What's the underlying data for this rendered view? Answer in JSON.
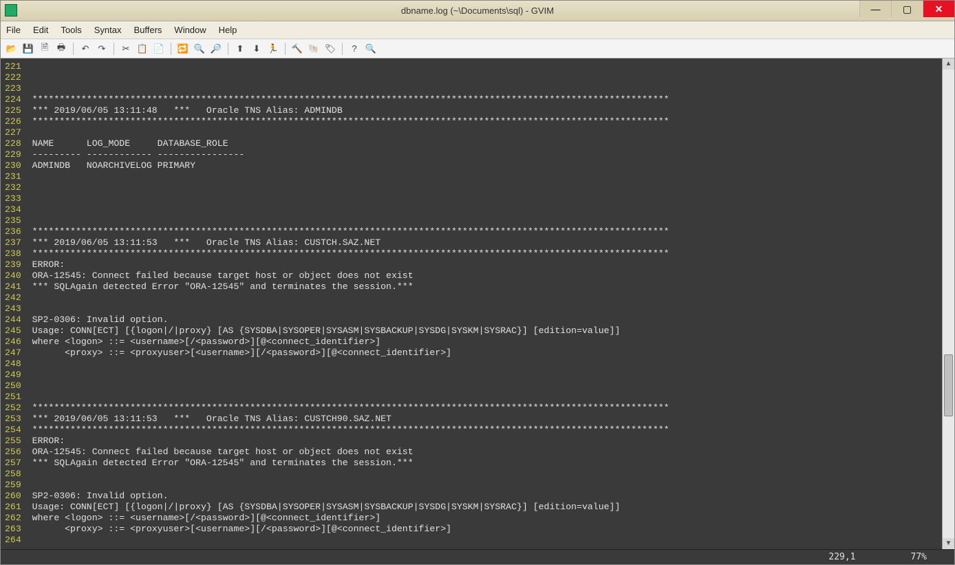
{
  "window": {
    "title": "dbname.log (~\\Documents\\sql) - GVIM",
    "icon": "gvim-icon"
  },
  "window_controls": {
    "min": "—",
    "max": "▢",
    "close": "✕"
  },
  "menubar": [
    "File",
    "Edit",
    "Tools",
    "Syntax",
    "Buffers",
    "Window",
    "Help"
  ],
  "toolbar_icons": [
    {
      "name": "open-icon",
      "glyph": "📂"
    },
    {
      "name": "save-icon",
      "glyph": "💾"
    },
    {
      "name": "save-all-icon",
      "glyph": "🗎"
    },
    {
      "name": "print-icon",
      "glyph": "🖶"
    },
    {
      "sep": true
    },
    {
      "name": "undo-icon",
      "glyph": "↶"
    },
    {
      "name": "redo-icon",
      "glyph": "↷"
    },
    {
      "sep": true
    },
    {
      "name": "cut-icon",
      "glyph": "✂"
    },
    {
      "name": "copy-icon",
      "glyph": "📋"
    },
    {
      "name": "paste-icon",
      "glyph": "📄"
    },
    {
      "sep": true
    },
    {
      "name": "replace-icon",
      "glyph": "🔁"
    },
    {
      "name": "find-next-icon",
      "glyph": "🔍"
    },
    {
      "name": "find-prev-icon",
      "glyph": "🔎"
    },
    {
      "sep": true
    },
    {
      "name": "load-session-icon",
      "glyph": "⬆"
    },
    {
      "name": "save-session-icon",
      "glyph": "⬇"
    },
    {
      "name": "run-script-icon",
      "glyph": "🏃"
    },
    {
      "sep": true
    },
    {
      "name": "make-icon",
      "glyph": "🔨"
    },
    {
      "name": "shell-icon",
      "glyph": "🐚"
    },
    {
      "name": "tags-icon",
      "glyph": "🏷"
    },
    {
      "sep": true
    },
    {
      "name": "help-icon",
      "glyph": "?"
    },
    {
      "name": "find-help-icon",
      "glyph": "🔍"
    }
  ],
  "lines": [
    {
      "n": "221",
      "t": ""
    },
    {
      "n": "222",
      "t": ""
    },
    {
      "n": "223",
      "t": ""
    },
    {
      "n": "224",
      "t": " *********************************************************************************************************************"
    },
    {
      "n": "225",
      "t": " *** 2019/06/05 13:11:48   ***   Oracle TNS Alias: ADMINDB"
    },
    {
      "n": "226",
      "t": " *********************************************************************************************************************"
    },
    {
      "n": "227",
      "t": ""
    },
    {
      "n": "228",
      "t": " NAME      LOG_MODE     DATABASE_ROLE"
    },
    {
      "n": "229",
      "t": " --------- ------------ ----------------"
    },
    {
      "n": "230",
      "t": " ADMINDB   NOARCHIVELOG PRIMARY"
    },
    {
      "n": "231",
      "t": ""
    },
    {
      "n": "232",
      "t": ""
    },
    {
      "n": "233",
      "t": ""
    },
    {
      "n": "234",
      "t": ""
    },
    {
      "n": "235",
      "t": ""
    },
    {
      "n": "236",
      "t": " *********************************************************************************************************************"
    },
    {
      "n": "237",
      "t": " *** 2019/06/05 13:11:53   ***   Oracle TNS Alias: CUSTCH.SAZ.NET"
    },
    {
      "n": "238",
      "t": " *********************************************************************************************************************"
    },
    {
      "n": "239",
      "t": " ERROR:"
    },
    {
      "n": "240",
      "t": " ORA-12545: Connect failed because target host or object does not exist"
    },
    {
      "n": "241",
      "t": " *** SQLAgain detected Error \"ORA-12545\" and terminates the session.***"
    },
    {
      "n": "242",
      "t": ""
    },
    {
      "n": "243",
      "t": ""
    },
    {
      "n": "244",
      "t": " SP2-0306: Invalid option."
    },
    {
      "n": "245",
      "t": " Usage: CONN[ECT] [{logon|/|proxy} [AS {SYSDBA|SYSOPER|SYSASM|SYSBACKUP|SYSDG|SYSKM|SYSRAC}] [edition=value]]"
    },
    {
      "n": "246",
      "t": " where <logon> ::= <username>[/<password>][@<connect_identifier>]"
    },
    {
      "n": "247",
      "t": "       <proxy> ::= <proxyuser>[<username>][/<password>][@<connect_identifier>]"
    },
    {
      "n": "248",
      "t": ""
    },
    {
      "n": "249",
      "t": ""
    },
    {
      "n": "250",
      "t": ""
    },
    {
      "n": "251",
      "t": ""
    },
    {
      "n": "252",
      "t": " *********************************************************************************************************************"
    },
    {
      "n": "253",
      "t": " *** 2019/06/05 13:11:53   ***   Oracle TNS Alias: CUSTCH90.SAZ.NET"
    },
    {
      "n": "254",
      "t": " *********************************************************************************************************************"
    },
    {
      "n": "255",
      "t": " ERROR:"
    },
    {
      "n": "256",
      "t": " ORA-12545: Connect failed because target host or object does not exist"
    },
    {
      "n": "257",
      "t": " *** SQLAgain detected Error \"ORA-12545\" and terminates the session.***"
    },
    {
      "n": "258",
      "t": ""
    },
    {
      "n": "259",
      "t": ""
    },
    {
      "n": "260",
      "t": " SP2-0306: Invalid option."
    },
    {
      "n": "261",
      "t": " Usage: CONN[ECT] [{logon|/|proxy} [AS {SYSDBA|SYSOPER|SYSASM|SYSBACKUP|SYSDG|SYSKM|SYSRAC}] [edition=value]]"
    },
    {
      "n": "262",
      "t": " where <logon> ::= <username>[/<password>][@<connect_identifier>]"
    },
    {
      "n": "263",
      "t": "       <proxy> ::= <proxyuser>[<username>][/<password>][@<connect_identifier>]"
    },
    {
      "n": "264",
      "t": ""
    }
  ],
  "status": {
    "position": "229,1",
    "percent": "77%"
  }
}
